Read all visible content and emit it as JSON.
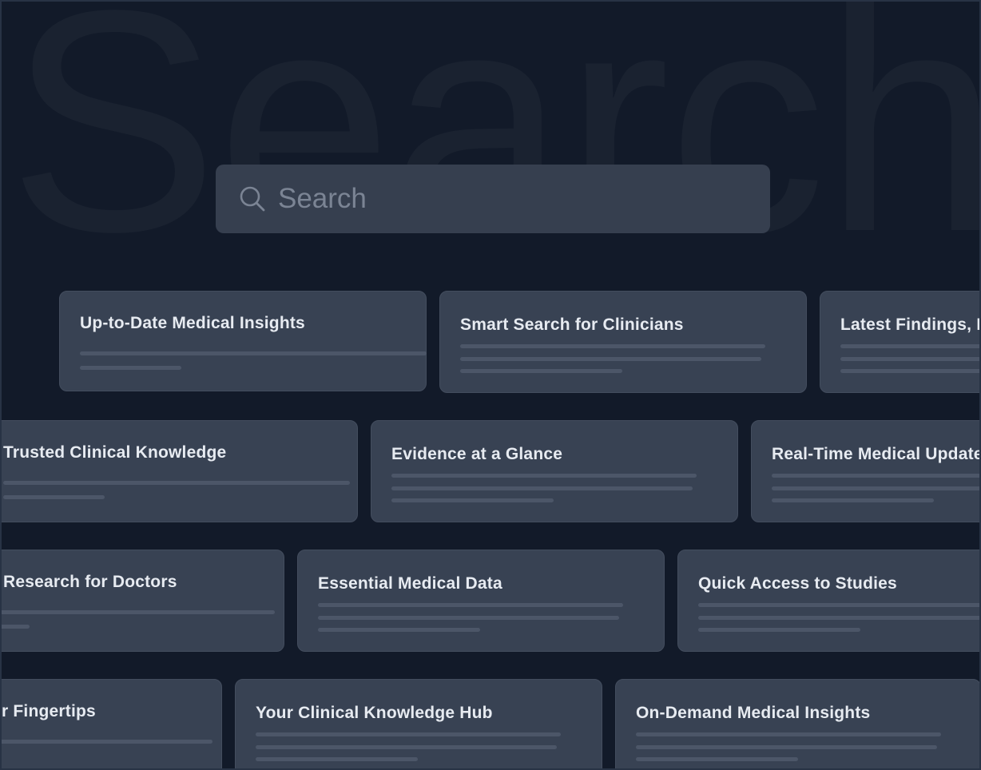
{
  "background_word": "Search",
  "search": {
    "placeholder": "Search",
    "icon": "search-icon"
  },
  "colors": {
    "page_background": "#121a29",
    "card_background": "#384253",
    "search_background": "#363f4f",
    "title_text": "#e7ebf1",
    "skeleton_line": "#4c5668"
  },
  "cards": [
    {
      "title": "Up-to-Date Medical Insights"
    },
    {
      "title": "Smart Search for Clinicians"
    },
    {
      "title": "Latest Findings, F"
    },
    {
      "title": "Trusted Clinical Knowledge"
    },
    {
      "title": "Evidence at a Glance"
    },
    {
      "title": "Real-Time Medical Update"
    },
    {
      "title": "Research for Doctors"
    },
    {
      "title": "Essential Medical Data"
    },
    {
      "title": "Quick Access to Studies"
    },
    {
      "title": "r Fingertips"
    },
    {
      "title": "Your Clinical Knowledge Hub"
    },
    {
      "title": "On-Demand Medical Insights"
    }
  ]
}
